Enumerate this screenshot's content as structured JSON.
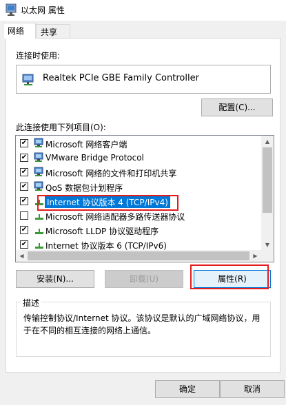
{
  "window": {
    "title": "以太网 属性",
    "icon": "network-adapter-icon"
  },
  "tabs": [
    {
      "label": "网络",
      "active": true
    },
    {
      "label": "共享",
      "active": false
    }
  ],
  "connect_using": {
    "label": "连接时使用:",
    "adapter": "Realtek PCIe GBE Family Controller",
    "config_button": "配置(C)..."
  },
  "items_label": "此连接使用下列项目(O):",
  "items": [
    {
      "label": "Microsoft 网络客户端",
      "checked": true,
      "icon": "network-client-icon",
      "selected": false
    },
    {
      "label": "VMware Bridge Protocol",
      "checked": true,
      "icon": "network-service-icon",
      "selected": false
    },
    {
      "label": "Microsoft 网络的文件和打印机共享",
      "checked": true,
      "icon": "network-service-icon",
      "selected": false
    },
    {
      "label": "QoS 数据包计划程序",
      "checked": true,
      "icon": "network-service-icon",
      "selected": false
    },
    {
      "label": "Internet 协议版本 4 (TCP/IPv4)",
      "checked": true,
      "icon": "protocol-icon",
      "selected": true
    },
    {
      "label": "Microsoft 网络适配器多路传送器协议",
      "checked": false,
      "icon": "protocol-icon",
      "selected": false
    },
    {
      "label": "Microsoft LLDP 协议驱动程序",
      "checked": true,
      "icon": "protocol-icon",
      "selected": false
    },
    {
      "label": "Internet 协议版本 6 (TCP/IPv6)",
      "checked": true,
      "icon": "protocol-icon",
      "selected": false
    }
  ],
  "buttons": {
    "install": "安装(N)...",
    "uninstall": "卸载(U)",
    "properties": "属性(R)",
    "ok": "确定",
    "cancel": "取消"
  },
  "description": {
    "title": "描述",
    "text": "传输控制协议/Internet 协议。该协议是默认的广域网络协议，用于在不同的相互连接的网络上通信。"
  },
  "colors": {
    "highlight": "#0078d7",
    "annotation": "#e41b1b"
  }
}
